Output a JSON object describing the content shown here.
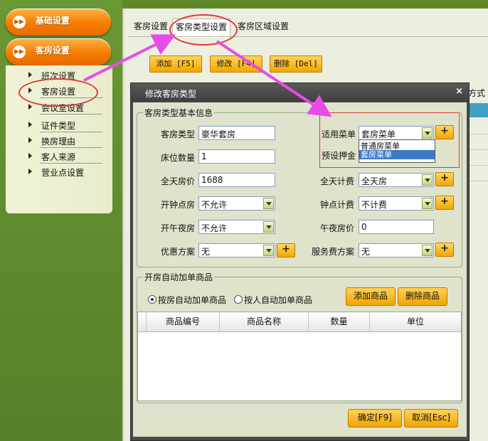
{
  "sidebar": {
    "section1": "基础设置",
    "section2": "客房设置",
    "items": [
      "班次设置",
      "客房设置",
      "会议室设置",
      "证件类型",
      "换房理由",
      "客人来源",
      "营业点设置"
    ]
  },
  "tabs": [
    "客房设置",
    "客房类型设置",
    "客房区域设置"
  ],
  "toolbar": {
    "add": "添加 [F5]",
    "edit": "修改 [F4]",
    "delete": "删除 [Del]"
  },
  "bg_partial_text": "方式",
  "dialog": {
    "title": "修改客房类型",
    "close": "×",
    "basic": {
      "legend": "客房类型基本信息",
      "room_type_label": "客房类型",
      "room_type_value": "豪华套房",
      "bed_count_label": "床位数量",
      "bed_count_value": "1",
      "full_day_price_label": "全天房价",
      "full_day_price_value": "1688",
      "hourly_room_label": "开钟点房",
      "hourly_room_value": "不允许",
      "midnight_room_label": "开午夜房",
      "midnight_room_value": "不允许",
      "discount_label": "优惠方案",
      "discount_value": "无",
      "menu_label": "适用菜单",
      "menu_value": "套房菜单",
      "deposit_label": "预设押金",
      "full_day_billing_label": "全天计费",
      "full_day_billing_value": "全天房",
      "hourly_billing_label": "钟点计费",
      "hourly_billing_value": "不计费",
      "midnight_price_label": "午夜房价",
      "midnight_price_value": "0",
      "service_fee_label": "服务费方案",
      "service_fee_value": "无",
      "plus": "+"
    },
    "menu_dropdown_options": [
      "普通房菜单",
      "套房菜单"
    ],
    "auto_add": {
      "legend": "开房自动加单商品",
      "radio_room": "按房自动加单商品",
      "radio_person": "按人自动加单商品",
      "add_goods": "添加商品",
      "delete_goods": "删除商品",
      "columns": [
        "商品编号",
        "商品名称",
        "数量",
        "单位"
      ]
    },
    "ok": "确定[F9]",
    "cancel": "取消[Esc]"
  },
  "colors": {
    "accent_orange": "#f57c00",
    "highlight_blue": "#3b79c6",
    "annotation": "#e03a3a",
    "arrow": "#e84ce8"
  }
}
